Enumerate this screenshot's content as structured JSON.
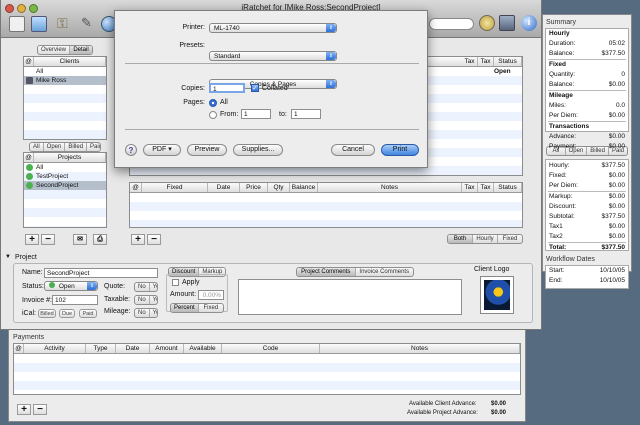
{
  "window": {
    "title": "iRatchet for [Mike Ross:SecondProject]"
  },
  "tabs": {
    "overview": "Overview",
    "detail": "Detail"
  },
  "clients": {
    "header": "Clients",
    "at": "@",
    "items": [
      "All",
      "Mike Ross"
    ]
  },
  "client_filter": [
    "All",
    "Open",
    "Billed",
    "Paid"
  ],
  "projects": {
    "header": "Projects",
    "at": "@",
    "items": [
      "All",
      "TestProject",
      "SecondProject"
    ]
  },
  "entries_columns_right": {
    "tax1": "Tax",
    "tax2": "Tax",
    "status": "Status",
    "row_status": "Open"
  },
  "expenses": {
    "columns": [
      "@",
      "Fixed",
      "Date",
      "Price",
      "Qty",
      "Balance",
      "Notes",
      "Tax",
      "Tax",
      "Status"
    ]
  },
  "expense_filter": [
    "Both",
    "Hourly",
    "Fixed"
  ],
  "project_panel": {
    "title": "Project",
    "name_label": "Name:",
    "name_value": "SecondProject",
    "status_label": "Status:",
    "status_value": "Open",
    "quote_label": "Quote:",
    "invoice_label": "Invoice #:",
    "invoice_value": "102",
    "taxable_label": "Taxable:",
    "ical_label": "iCal:",
    "ical_options": [
      "Billed",
      "Due",
      "Paid"
    ],
    "mileage_label": "Mileage:",
    "no": "No",
    "yes": "Yes",
    "discount_tab": "Discount",
    "markup_tab": "Markup",
    "apply_label": "Apply",
    "amount_label": "Amount:",
    "amount_value": "0.00%",
    "percent": "Percent",
    "fixed": "Fixed",
    "comment_tabs": [
      "Project Comments",
      "Invoice Comments"
    ],
    "client_logo": "Client Logo"
  },
  "payments": {
    "title": "Payments",
    "columns": [
      "@",
      "Activity",
      "Type",
      "Date",
      "Amount",
      "Available",
      "Code",
      "Notes"
    ],
    "client_advance_label": "Available Client Advance:",
    "client_advance": "$0.00",
    "project_advance_label": "Available Project Advance:",
    "project_advance": "$0.00"
  },
  "summary": {
    "title": "Summary",
    "hourly": {
      "head": "Hourly",
      "rows": [
        [
          "Duration:",
          "05:02"
        ],
        [
          "Balance:",
          "$377.50"
        ]
      ]
    },
    "fixed": {
      "head": "Fixed",
      "rows": [
        [
          "Quantity:",
          "0"
        ],
        [
          "Balance:",
          "$0.00"
        ]
      ]
    },
    "mileage": {
      "head": "Mileage",
      "rows": [
        [
          "Miles:",
          "0.0"
        ],
        [
          "Per Diem:",
          "$0.00"
        ]
      ]
    },
    "transactions": {
      "head": "Transactions",
      "rows": [
        [
          "Advance:",
          "$0.00"
        ],
        [
          "Payment:",
          "$0.00"
        ]
      ]
    },
    "filter": [
      "All",
      "Open",
      "Billed",
      "Paid"
    ],
    "totals": [
      [
        "Hourly:",
        "$377.50"
      ],
      [
        "Fixed:",
        "$0.00"
      ],
      [
        "Per Diem:",
        "$0.00"
      ],
      [
        "Markup:",
        "$0.00"
      ],
      [
        "Discount:",
        "$0.00"
      ],
      [
        "Subtotal:",
        "$377.50"
      ],
      [
        "Tax1",
        "$0.00"
      ],
      [
        "Tax2",
        "$0.00"
      ],
      [
        "Total:",
        "$377.50"
      ]
    ],
    "workflow_title": "Workflow Dates",
    "start_label": "Start:",
    "start_value": "10/10/05",
    "end_label": "End:",
    "end_value": "10/10/05"
  },
  "print_dialog": {
    "printer_label": "Printer:",
    "printer_value": "ML-1740",
    "presets_label": "Presets:",
    "presets_value": "Standard",
    "section_value": "Copies & Pages",
    "copies_label": "Copies:",
    "copies_value": "1",
    "collated_label": "Collated",
    "collated": true,
    "pages_label": "Pages:",
    "all_label": "All",
    "from_label": "From:",
    "from_value": "1",
    "to_label": "to:",
    "to_value": "1",
    "help": "?",
    "pdf": "PDF ▾",
    "preview": "Preview",
    "supplies": "Supplies...",
    "cancel": "Cancel",
    "print": "Print"
  }
}
